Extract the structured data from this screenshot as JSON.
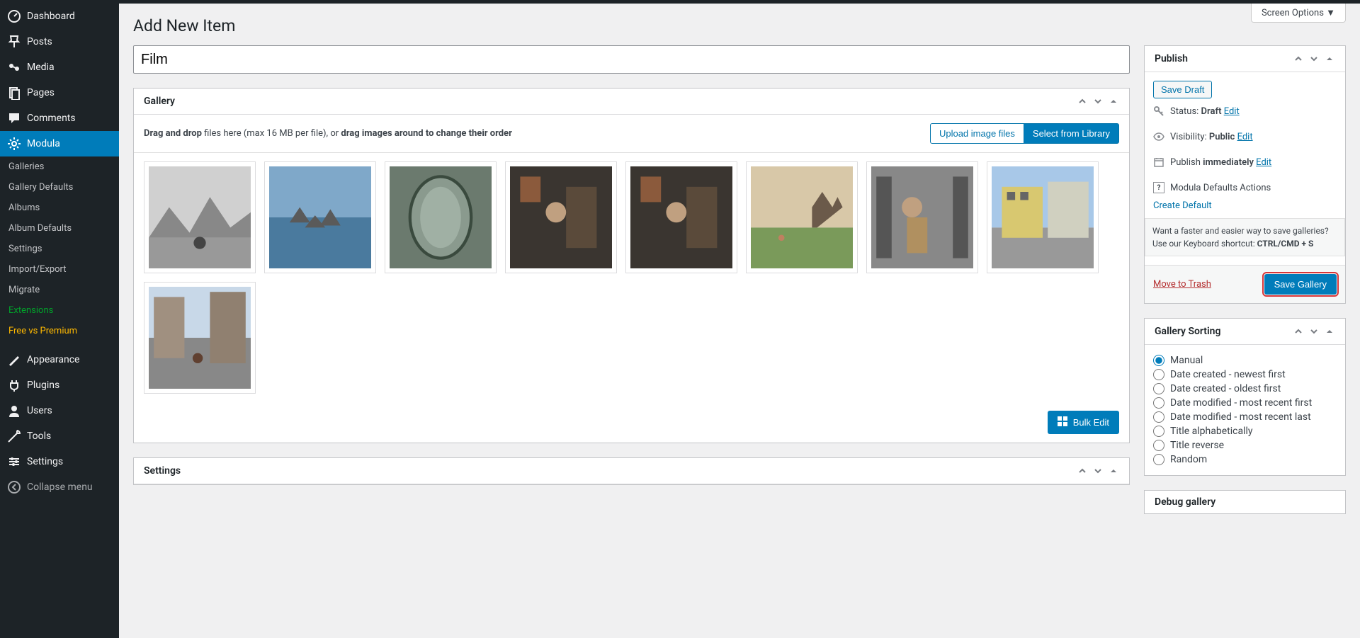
{
  "screen_options": "Screen Options ▼",
  "page_title": "Add New Item",
  "title_value": "Film",
  "sidebar": {
    "items": [
      {
        "label": "Dashboard"
      },
      {
        "label": "Posts"
      },
      {
        "label": "Media"
      },
      {
        "label": "Pages"
      },
      {
        "label": "Comments"
      },
      {
        "label": "Modula"
      }
    ],
    "sub_items": [
      {
        "label": "Galleries"
      },
      {
        "label": "Gallery Defaults"
      },
      {
        "label": "Albums"
      },
      {
        "label": "Album Defaults"
      },
      {
        "label": "Settings"
      },
      {
        "label": "Import/Export"
      },
      {
        "label": "Migrate"
      },
      {
        "label": "Extensions"
      },
      {
        "label": "Free vs Premium"
      }
    ],
    "lower": [
      {
        "label": "Appearance"
      },
      {
        "label": "Plugins"
      },
      {
        "label": "Users"
      },
      {
        "label": "Tools"
      },
      {
        "label": "Settings"
      },
      {
        "label": "Collapse menu"
      }
    ]
  },
  "gallery_panel": {
    "title": "Gallery",
    "hint_1": "Drag and drop",
    "hint_2": " files here (max 16 MB per file), or ",
    "hint_3": "drag images around to change their order",
    "upload_btn": "Upload image files",
    "library_btn": "Select from Library",
    "bulk_edit": "Bulk Edit"
  },
  "settings_panel": {
    "title": "Settings"
  },
  "publish": {
    "title": "Publish",
    "save_draft": "Save Draft",
    "status_label": "Status: ",
    "status_value": "Draft",
    "visibility_label": "Visibility: ",
    "visibility_value": "Public",
    "publish_label": "Publish ",
    "publish_value": "immediately",
    "edit": "Edit",
    "defaults_label": "Modula Defaults Actions",
    "create_default": "Create Default",
    "tip_text": "Want a faster and easier way to save galleries? Use our Keyboard shortcut: ",
    "tip_shortcut": "CTRL/CMD + S",
    "trash": "Move to Trash",
    "save_btn": "Save Gallery"
  },
  "sorting": {
    "title": "Gallery Sorting",
    "options": [
      "Manual",
      "Date created - newest first",
      "Date created - oldest first",
      "Date modified - most recent first",
      "Date modified - most recent last",
      "Title alphabetically",
      "Title reverse",
      "Random"
    ]
  },
  "debug_title": "Debug gallery"
}
